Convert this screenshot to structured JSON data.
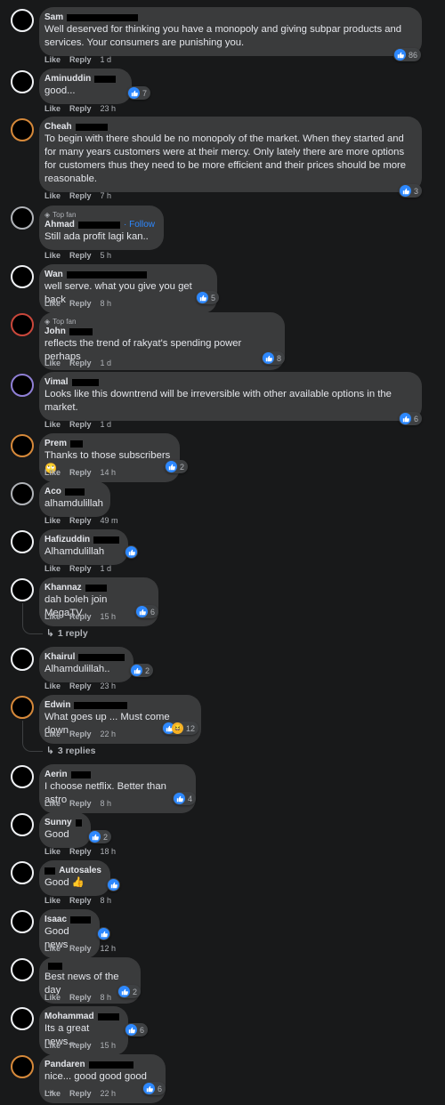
{
  "actions": {
    "like": "Like",
    "reply": "Reply"
  },
  "comments": [
    {
      "name": "Sam",
      "text": "Well deserved for thinking you have a monopoly and giving subpar products and services. Your consumers are punishing you.",
      "time": "1 d",
      "reactions": "86"
    },
    {
      "name": "Aminuddin",
      "text": "good...",
      "time": "23 h",
      "reactions": "7"
    },
    {
      "name": "Cheah",
      "text": "To begin with there should be no monopoly of the market. When they started and for many years customers were at their mercy. Only lately there are more options for customers thus they need to be more efficient and their prices should be more reasonable.",
      "time": "7 h",
      "reactions": "3"
    },
    {
      "badge": "Top fan",
      "name": "Ahmad",
      "follow": "· Follow",
      "text": "Still ada profit lagi kan..",
      "time": "5 h",
      "reactions": ""
    },
    {
      "name": "Wan",
      "text": "well serve. what you give you get back",
      "time": "8 h",
      "reactions": "5"
    },
    {
      "badge": "Top fan",
      "name": "John",
      "text": "reflects the trend of rakyat's spending power perhaps",
      "time": "1 d",
      "reactions": "8"
    },
    {
      "name": "Vimal",
      "text": "Looks like this downtrend will be irreversible with other available options in the market.",
      "time": "1 d",
      "reactions": "6"
    },
    {
      "name": "Prem",
      "text": "Thanks to those subscribers 🙄",
      "time": "14 h",
      "reactions": "2"
    },
    {
      "name": "Aco",
      "text": "alhamdulillah",
      "time": "49 m",
      "reactions": ""
    },
    {
      "name": "Hafizuddin",
      "text": "Alhamdulillah",
      "time": "1 d",
      "reactions": ""
    },
    {
      "name": "Khannaz",
      "text": "dah boleh join MegaTV..",
      "time": "15 h",
      "reactions": "6",
      "replies": "1 reply"
    },
    {
      "name": "Khairul",
      "text": "Alhamdulillah..",
      "time": "23 h",
      "reactions": "2"
    },
    {
      "name": "Edwin",
      "text": "What goes up ... Must come down",
      "time": "22 h",
      "reactions": "12",
      "replies": "3 replies"
    },
    {
      "name": "Aerin",
      "text": "I choose netflix. Better than astro",
      "time": "8 h",
      "reactions": "4"
    },
    {
      "name": "Sunny",
      "text": "Good",
      "time": "18 h",
      "reactions": "2"
    },
    {
      "name": "Autosales",
      "text": "Good 👍",
      "time": "8 h",
      "reactions": ""
    },
    {
      "name": "Isaac",
      "text": "Good news",
      "time": "12 h",
      "reactions": ""
    },
    {
      "name": "",
      "text": "Best news of the day",
      "time": "8 h",
      "reactions": "2"
    },
    {
      "name": "Mohammad",
      "text": "Its a great news...",
      "time": "15 h",
      "reactions": "6"
    },
    {
      "name": "Pandaren",
      "text": "nice... good good good ...",
      "time": "22 h",
      "reactions": "6"
    }
  ]
}
